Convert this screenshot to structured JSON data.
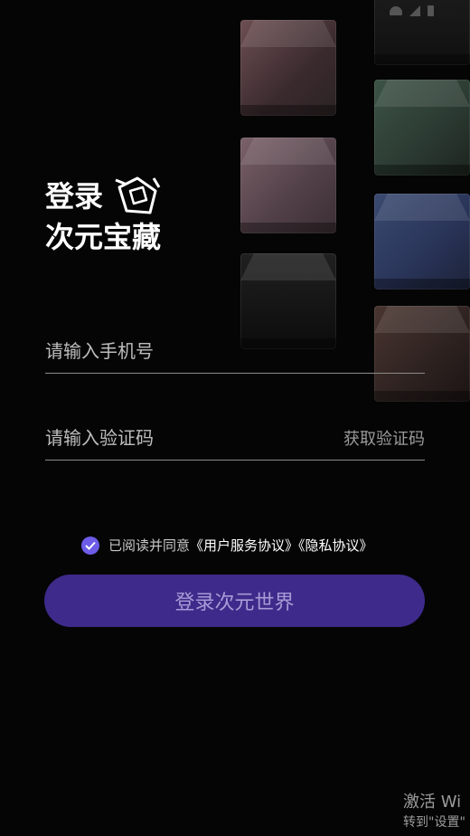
{
  "title": {
    "line1": "登录",
    "line2": "次元宝藏"
  },
  "form": {
    "phone_placeholder": "请输入手机号",
    "code_placeholder": "请输入验证码",
    "get_code_label": "获取验证码"
  },
  "agreement": {
    "prefix": "已阅读并同意",
    "user_agreement": "《用户服务协议》",
    "privacy_policy": "《隐私协议》",
    "checked": true
  },
  "login_button": {
    "label": "登录次元世界"
  },
  "watermark": {
    "line1": "激活 Wi",
    "line2": "转到\"设置\""
  },
  "colors": {
    "background": "#050505",
    "accent": "#6c5ce7",
    "button": "#3e2a8a",
    "button_text": "#a79bd6"
  },
  "icons": [
    "wifi-icon",
    "signal-icon",
    "battery-icon",
    "logo-icon",
    "checkmark-icon"
  ]
}
